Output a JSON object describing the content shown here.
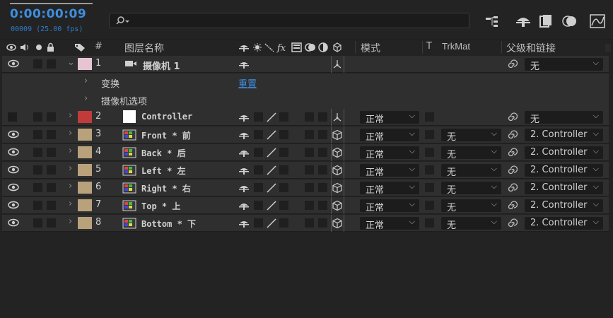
{
  "timecode": "0:00:00:09",
  "frame_info": "00009 (25.00 fps)",
  "search": {
    "placeholder": ""
  },
  "header": {
    "layer_name": "图层名称",
    "mode": "模式",
    "t": "T",
    "trkmat": "TrkMat",
    "parent": "父级和链接"
  },
  "colors": {
    "accent": "#3d8fe0",
    "camera_label": "#e7c4d2",
    "controller_label": "#c23b3b",
    "solid_label": "#b9a17c"
  },
  "layers": [
    {
      "index": "1",
      "name": "摄像机 1",
      "type": "camera",
      "parent": "无"
    },
    {
      "index": "2",
      "name": "Controller",
      "type": "null",
      "mode": "正常",
      "parent": "无"
    },
    {
      "index": "3",
      "name": "Front * 前",
      "type": "comp",
      "mode": "正常",
      "trkmat": "无",
      "parent": "2. Controller"
    },
    {
      "index": "4",
      "name": "Back * 后",
      "type": "comp",
      "mode": "正常",
      "trkmat": "无",
      "parent": "2. Controller"
    },
    {
      "index": "5",
      "name": "Left * 左",
      "type": "comp",
      "mode": "正常",
      "trkmat": "无",
      "parent": "2. Controller"
    },
    {
      "index": "6",
      "name": "Right * 右",
      "type": "comp",
      "mode": "正常",
      "trkmat": "无",
      "parent": "2. Controller"
    },
    {
      "index": "7",
      "name": "Top * 上",
      "type": "comp",
      "mode": "正常",
      "trkmat": "无",
      "parent": "2. Controller"
    },
    {
      "index": "8",
      "name": "Bottom * 下",
      "type": "comp",
      "mode": "正常",
      "trkmat": "无",
      "parent": "2. Controller"
    }
  ],
  "camera_props": {
    "transform": "变换",
    "reset": "重置",
    "camera_options": "摄像机选项"
  }
}
